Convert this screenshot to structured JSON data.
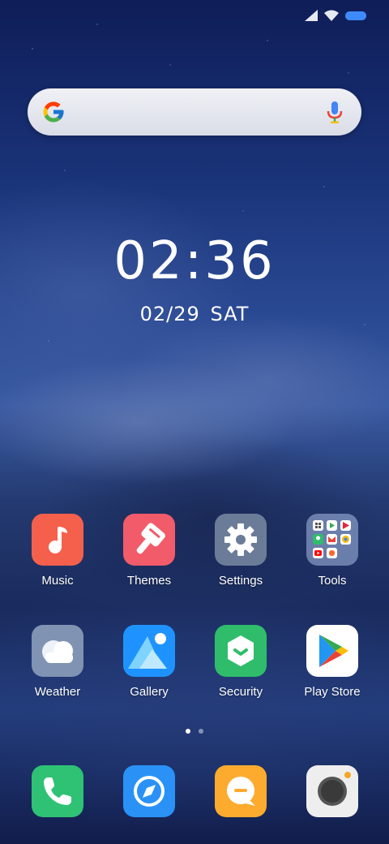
{
  "status_bar": {
    "signal_icon": "signal-icon",
    "wifi_icon": "wifi-icon",
    "battery_icon": "battery-icon",
    "battery_color": "#3d8bff"
  },
  "search": {
    "logo_icon": "google-icon",
    "voice_icon": "mic-icon"
  },
  "clock": {
    "time": "02:36",
    "date": "02/29",
    "day": "SAT"
  },
  "apps": {
    "row1": [
      {
        "label": "Music",
        "icon": "music-note-icon",
        "color": "#f5604d"
      },
      {
        "label": "Themes",
        "icon": "brush-icon",
        "color": "#f25b6a"
      },
      {
        "label": "Settings",
        "icon": "gear-icon",
        "color": "#6b7c98"
      },
      {
        "label": "Tools",
        "icon": "folder-icon",
        "color": "#8fa6d6"
      }
    ],
    "row2": [
      {
        "label": "Weather",
        "icon": "cloud-icon",
        "color": "#8193b2"
      },
      {
        "label": "Gallery",
        "icon": "mountain-icon",
        "color": "#1e93ff"
      },
      {
        "label": "Security",
        "icon": "shield-icon",
        "color": "#2fbd6b"
      },
      {
        "label": "Play Store",
        "icon": "play-store-icon",
        "color": "#ffffff"
      }
    ]
  },
  "page_indicator": {
    "current": 1,
    "total": 2
  },
  "dock": [
    {
      "icon": "phone-icon",
      "color": "#2fc275"
    },
    {
      "icon": "compass-icon",
      "color": "#2a92f6"
    },
    {
      "icon": "message-icon",
      "color": "#fdab2e"
    },
    {
      "icon": "camera-icon",
      "color": "#eeeeee"
    }
  ]
}
